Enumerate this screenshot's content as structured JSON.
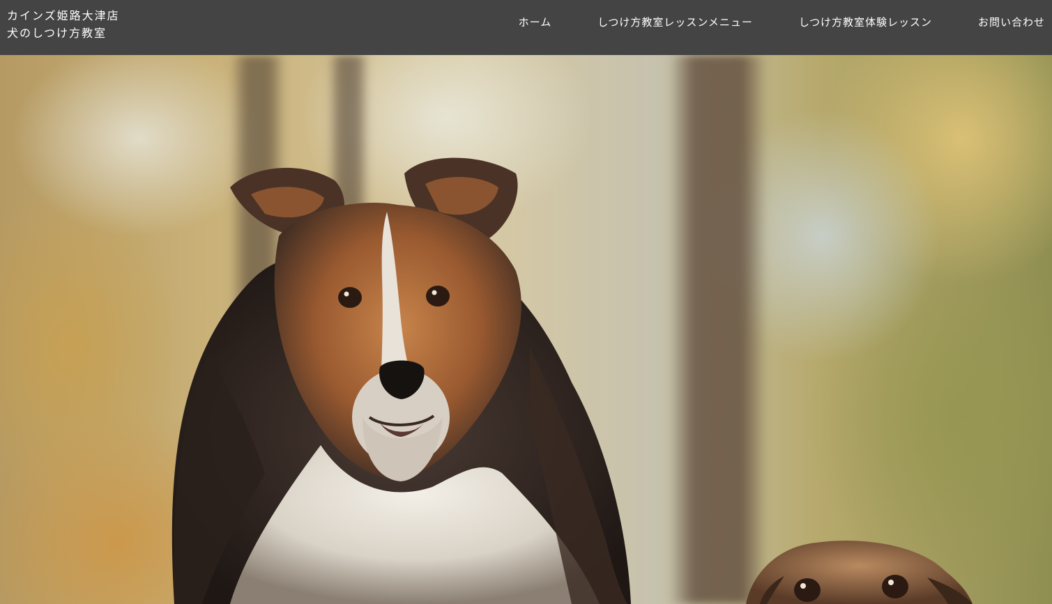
{
  "header": {
    "title_line1": "カインズ姫路大津店",
    "title_line2": "犬のしつけ方教室"
  },
  "nav": {
    "items": [
      {
        "label": "ホーム"
      },
      {
        "label": "しつけ方教室レッスンメニュー"
      },
      {
        "label": "しつけ方教室体験レッスン"
      },
      {
        "label": "お問い合わせ"
      }
    ]
  },
  "hero": {
    "image_subject": "sheltie-and-dachshund-photo"
  },
  "colors": {
    "header_bg": "#444444",
    "header_text": "#ffffff"
  }
}
